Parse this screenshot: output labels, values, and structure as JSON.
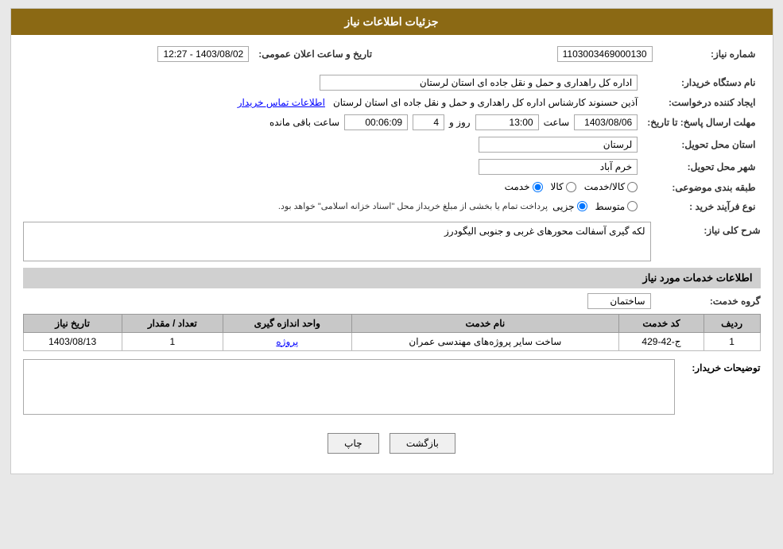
{
  "header": {
    "title": "جزئیات اطلاعات نیاز"
  },
  "fields": {
    "need_number_label": "شماره نیاز:",
    "need_number_value": "1103003469000130",
    "announcement_label": "تاریخ و ساعت اعلان عمومی:",
    "announcement_value": "1403/08/02 - 12:27",
    "org_name_label": "نام دستگاه خریدار:",
    "org_name_value": "اداره کل راهداری و حمل و نقل جاده ای استان لرستان",
    "creator_label": "ایجاد کننده درخواست:",
    "creator_value": "آذین حسنوند کارشناس اداره کل راهداری و حمل و نقل جاده ای استان لرستان",
    "contact_link": "اطلاعات تماس خریدار",
    "response_deadline_label": "مهلت ارسال پاسخ: تا تاریخ:",
    "response_date_value": "1403/08/06",
    "response_time_label": "ساعت",
    "response_time_value": "13:00",
    "response_days_label": "روز و",
    "response_days_value": "4",
    "remaining_label": "ساعت باقی مانده",
    "remaining_value": "00:06:09",
    "province_label": "استان محل تحویل:",
    "province_value": "لرستان",
    "city_label": "شهر محل تحویل:",
    "city_value": "خرم آباد",
    "subject_label": "طبقه بندی موضوعی:",
    "radio_service": "خدمت",
    "radio_goods": "کالا",
    "radio_service_goods": "کالا/خدمت",
    "purchase_type_label": "نوع فرآیند خرید :",
    "radio_partial": "جزیی",
    "radio_medium": "متوسط",
    "purchase_notice": "پرداخت تمام یا بخشی از مبلغ خریداز محل \"اسناد خزانه اسلامی\" خواهد بود.",
    "need_description_label": "شرح کلی نیاز:",
    "need_description_value": "لکه گیری آسفالت محورهای غربی و جنوبی الیگودرز",
    "services_section_title": "اطلاعات خدمات مورد نیاز",
    "service_group_label": "گروه خدمت:",
    "service_group_value": "ساختمان",
    "table_headers": {
      "row_num": "ردیف",
      "service_code": "کد خدمت",
      "service_name": "نام خدمت",
      "unit": "واحد اندازه گیری",
      "quantity": "تعداد / مقدار",
      "deadline": "تاریخ نیاز"
    },
    "table_rows": [
      {
        "row_num": "1",
        "service_code": "ج-42-429",
        "service_name": "ساخت سایر پروژه‌های مهندسی عمران",
        "unit": "پروژه",
        "quantity": "1",
        "deadline": "1403/08/13"
      }
    ],
    "buyer_notes_label": "توضیحات خریدار:",
    "buyer_notes_value": "",
    "btn_print": "چاپ",
    "btn_back": "بازگشت"
  }
}
